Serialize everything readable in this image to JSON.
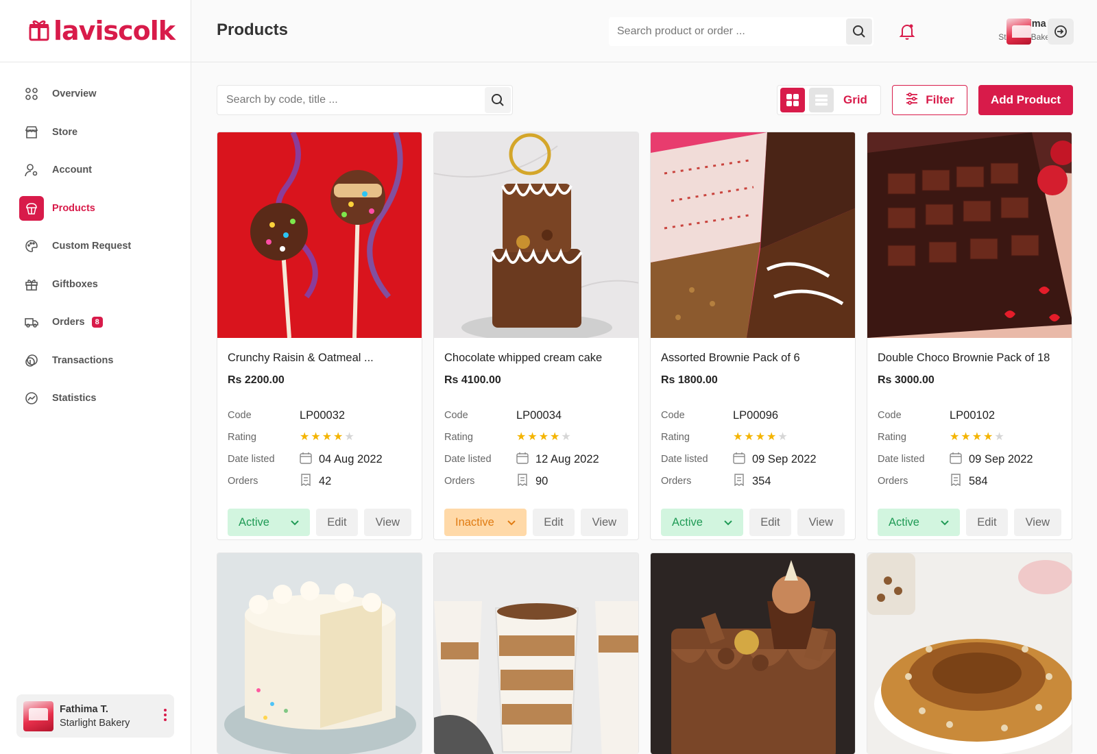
{
  "app": {
    "logo_text": "laviscolk"
  },
  "sidebar": {
    "items": [
      {
        "label": "Overview",
        "icon": "grid-icon"
      },
      {
        "label": "Store",
        "icon": "store-icon"
      },
      {
        "label": "Account",
        "icon": "user-settings-icon"
      },
      {
        "label": "Products",
        "icon": "cake-icon",
        "active": true
      },
      {
        "label": "Custom Request",
        "icon": "palette-icon"
      },
      {
        "label": "Giftboxes",
        "icon": "gift-icon"
      },
      {
        "label": "Orders",
        "icon": "truck-icon",
        "badge": "8"
      },
      {
        "label": "Transactions",
        "icon": "coins-icon"
      },
      {
        "label": "Statistics",
        "icon": "chart-icon"
      }
    ],
    "user": {
      "name": "Fathima T.",
      "shop": "Starlight Bakery"
    }
  },
  "header": {
    "title": "Products",
    "search_placeholder": "Search product or order ...",
    "user_name": "Fathima T.",
    "user_shop": "Starlight Bakery"
  },
  "toolbar": {
    "search_placeholder": "Search by code, title ...",
    "view_label": "Grid",
    "filter_label": "Filter",
    "add_label": "Add Product"
  },
  "labels": {
    "code": "Code",
    "rating": "Rating",
    "date_listed": "Date listed",
    "orders": "Orders",
    "edit": "Edit",
    "view": "View"
  },
  "products": [
    {
      "title": "Crunchy Raisin & Oatmeal ...",
      "price": "Rs 2200.00",
      "code": "LP00032",
      "rating": 4,
      "date": "04 Aug 2022",
      "orders": "42",
      "status": "Active"
    },
    {
      "title": "Chocolate whipped cream cake",
      "price": "Rs 4100.00",
      "code": "LP00034",
      "rating": 4,
      "date": "12 Aug 2022",
      "orders": "90",
      "status": "Inactive"
    },
    {
      "title": "Assorted Brownie Pack of 6",
      "price": "Rs 1800.00",
      "code": "LP00096",
      "rating": 4,
      "date": "09 Sep 2022",
      "orders": "354",
      "status": "Active"
    },
    {
      "title": "Double Choco Brownie Pack of 18",
      "price": "Rs 3000.00",
      "code": "LP00102",
      "rating": 4,
      "date": "09 Sep 2022",
      "orders": "584",
      "status": "Active"
    }
  ],
  "colors": {
    "brand": "#d81b4a",
    "active_bg": "#d2f5df",
    "active_fg": "#1f9a55",
    "inactive_bg": "#ffd9a8",
    "inactive_fg": "#e07b12",
    "star": "#f4b400"
  }
}
